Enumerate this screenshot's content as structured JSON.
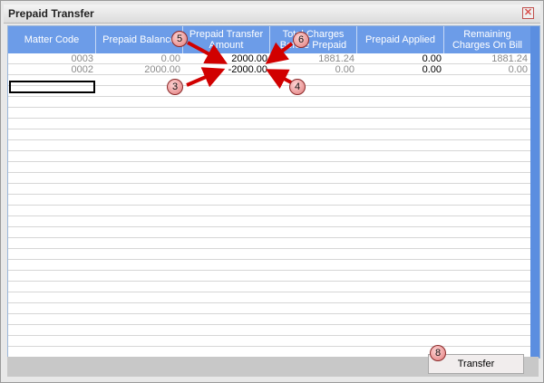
{
  "window": {
    "title": "Prepaid Transfer",
    "close_icon": "close-icon"
  },
  "columns": [
    "Matter Code",
    "Prepaid Balance",
    "Prepaid Transfer Amount",
    "Total Charges Before Prepaid",
    "Prepaid Applied",
    "Remaining Charges On Bill"
  ],
  "rows": [
    {
      "matter_code": "0003",
      "prepaid_balance": "0.00",
      "transfer_amount": "2000.00",
      "total_charges": "1881.24",
      "prepaid_applied": "0.00",
      "remaining_charges": "1881.24"
    },
    {
      "matter_code": "0002",
      "prepaid_balance": "2000.00",
      "transfer_amount": "-2000.00",
      "total_charges": "0.00",
      "prepaid_applied": "0.00",
      "remaining_charges": "0.00"
    }
  ],
  "callouts": [
    "5",
    "6",
    "3",
    "4",
    "8"
  ],
  "buttons": {
    "transfer": "Transfer"
  },
  "colors": {
    "header_bg": "#6c9ce8",
    "callout": "#e07a7a",
    "arrow": "#d10000"
  }
}
